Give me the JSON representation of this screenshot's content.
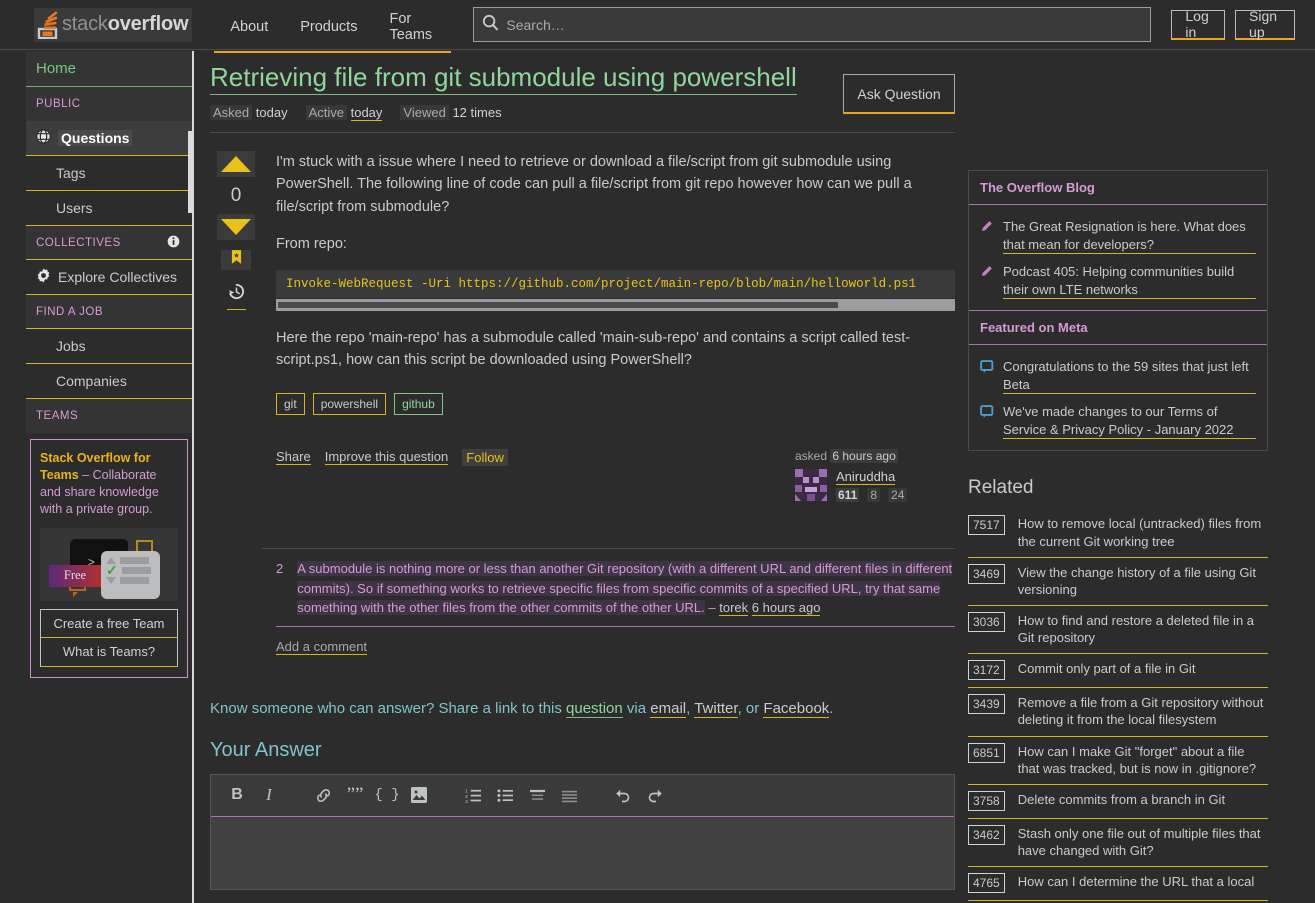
{
  "topnav": {
    "logo_text_light": "stack",
    "logo_text_bold": "overflow",
    "links": [
      "About",
      "Products",
      "For Teams"
    ],
    "search_placeholder": "Search…",
    "search_value": "",
    "login_label": "Log in",
    "signup_label": "Sign up"
  },
  "sidebar": {
    "home": "Home",
    "public_header": "PUBLIC",
    "public_items": [
      "Questions",
      "Tags",
      "Users"
    ],
    "collectives_header": "COLLECTIVES",
    "collectives_item": "Explore Collectives",
    "jobs_header": "FIND A JOB",
    "jobs_items": [
      "Jobs",
      "Companies"
    ],
    "teams_header": "TEAMS",
    "promo_title": "Stack Overflow for Teams",
    "promo_body": " – Collaborate and share knowledge with a private group.",
    "promo_free": "Free",
    "promo_prompt": ">_",
    "promo_prompt_q": "?",
    "btn_create": "Create a free Team",
    "btn_what": "What is Teams?"
  },
  "question": {
    "title": "Retrieving file from git submodule using powershell",
    "ask_button": "Ask Question",
    "meta": {
      "asked_key": "Asked",
      "asked_val": "today",
      "active_key": "Active",
      "active_val": "today",
      "viewed_key": "Viewed",
      "viewed_val": "12 times"
    },
    "votes": "0",
    "para1": "I'm stuck with a issue where I need to retrieve or download a file/script from git submodule using PowerShell. The following line of code can pull a file/script from git repo however how can we pull a file/script from submodule?",
    "para2": "From repo:",
    "code": "Invoke-WebRequest -Uri https://github.com/project/main-repo/blob/main/helloworld.ps1",
    "para3": "Here the repo 'main-repo' has a submodule called 'main-sub-repo' and contains a script called test-script.ps1, how can this script be downloaded using PowerShell?",
    "tags": [
      "git",
      "powershell",
      "github"
    ],
    "actions": {
      "share": "Share",
      "improve": "Improve this question",
      "follow": "Follow"
    },
    "asked_label": "asked",
    "asked_time": "6 hours ago",
    "author": "Aniruddha",
    "author_rep": "611",
    "author_gold": "8",
    "author_silver": "24"
  },
  "comment": {
    "score": "2",
    "text": "A submodule is nothing more or less than another Git repository (with a different URL and different files in different commits). So if something works to retrieve specific files from specific commits of a specified URL, try that same something with the other files from the other commits of the other URL.",
    "dash": "–",
    "author": "torek",
    "time": "6 hours ago",
    "add_comment": "Add a comment"
  },
  "share_prompt": {
    "lead": "Know someone who can answer? Share a link to this ",
    "question_word": "question",
    "via": " via ",
    "email": "email",
    "comma1": ", ",
    "twitter": "Twitter",
    "comma2": ", or ",
    "facebook": "Facebook",
    "period": "."
  },
  "answer": {
    "heading": "Your Answer",
    "toolbar": [
      "B",
      "I",
      "link",
      "quote",
      "code",
      "image",
      "numbered-list",
      "bullet-list",
      "heading",
      "hr",
      "undo",
      "redo"
    ],
    "textarea_value": ""
  },
  "rail": {
    "blog_header": "The Overflow Blog",
    "blog_items": [
      "The Great Resignation is here. What does that mean for developers?",
      "Podcast 405: Helping communities build their own LTE networks"
    ],
    "meta_header": "Featured on Meta",
    "meta_items": [
      "Congratulations to the 59 sites that just left Beta",
      "We've made changes to our Terms of Service & Privacy Policy - January 2022"
    ],
    "related_title": "Related",
    "related": [
      {
        "score": "7517",
        "title": "How to remove local (untracked) files from the current Git working tree"
      },
      {
        "score": "3469",
        "title": "View the change history of a file using Git versioning"
      },
      {
        "score": "3036",
        "title": "How to find and restore a deleted file in a Git repository"
      },
      {
        "score": "3172",
        "title": "Commit only part of a file in Git"
      },
      {
        "score": "3439",
        "title": "Remove a file from a Git repository without deleting it from the local filesystem"
      },
      {
        "score": "6851",
        "title": "How can I make Git \"forget\" about a file that was tracked, but is now in .gitignore?"
      },
      {
        "score": "3758",
        "title": "Delete commits from a branch in Git"
      },
      {
        "score": "3462",
        "title": "Stash only one file out of multiple files that have changed with Git?"
      },
      {
        "score": "4765",
        "title": "How can I determine the URL that a local"
      }
    ]
  },
  "colors": {
    "accent_yellow": "#e8c21a",
    "link_green": "#8fd69a",
    "comment_pink": "#d79ad4",
    "teal": "#7fc4cc"
  }
}
